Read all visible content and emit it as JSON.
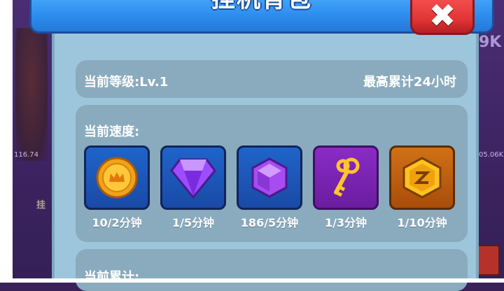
{
  "title": "挂机背包",
  "level_text": "当前等级:Lv.1",
  "max_text": "最高累计24小时",
  "speed_label": "当前速度:",
  "accum_label": "当前累计:",
  "items": [
    {
      "icon": "gold-coin-icon",
      "rate": "10/2分钟"
    },
    {
      "icon": "purple-diamond-icon",
      "rate": "1/5分钟"
    },
    {
      "icon": "purple-gem-icon",
      "rate": "186/5分钟"
    },
    {
      "icon": "gold-key-icon",
      "rate": "1/3分钟"
    },
    {
      "icon": "hex-token-icon",
      "rate": "1/10分钟"
    }
  ],
  "background": {
    "left_value": "116.74",
    "right_value": "05.06K",
    "right_big": "9K",
    "left_tag": "挂"
  }
}
